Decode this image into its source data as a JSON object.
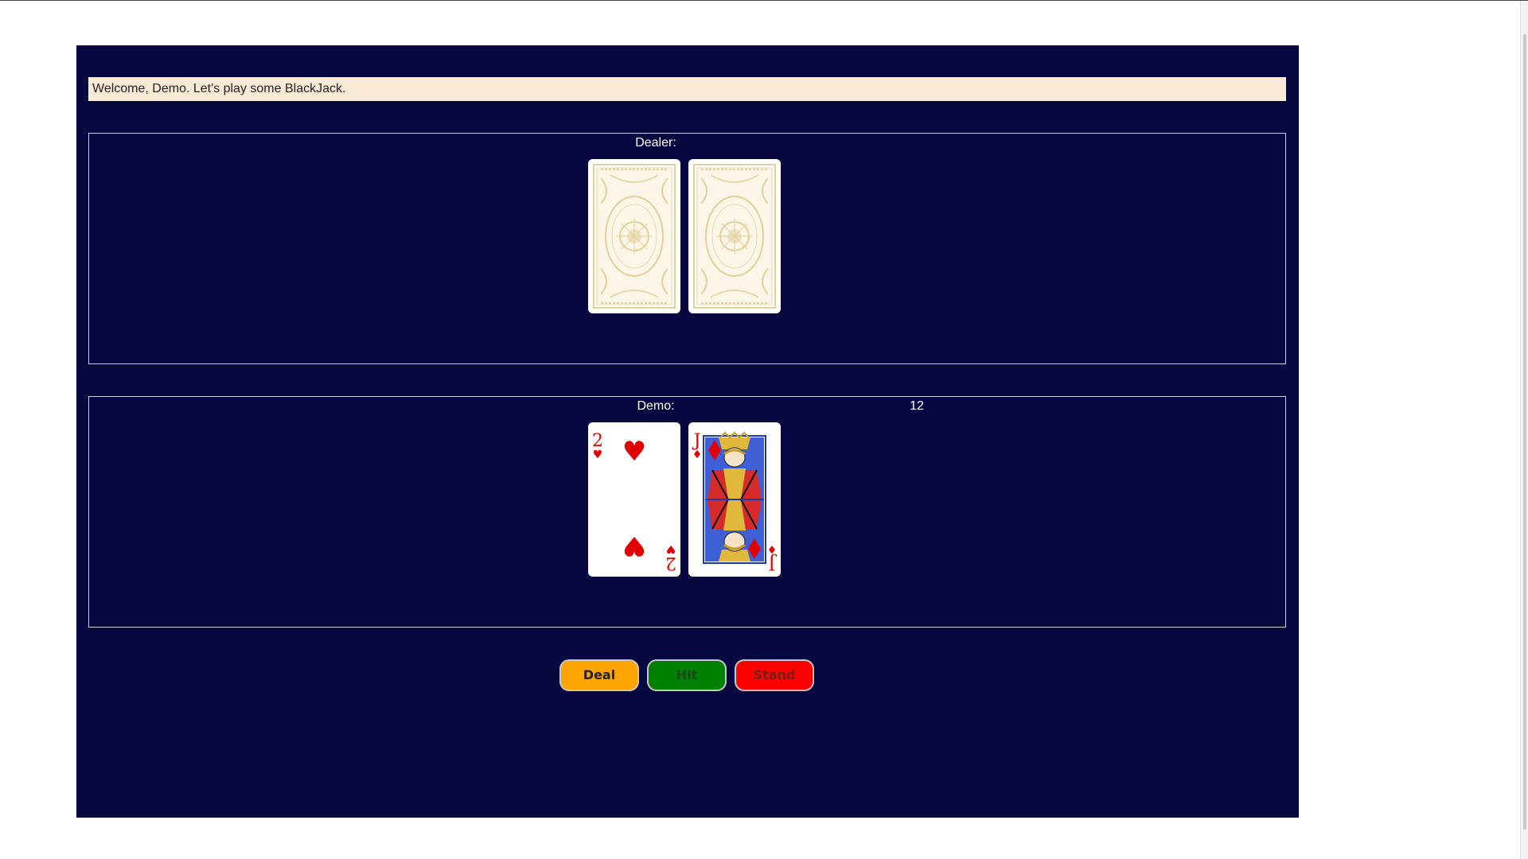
{
  "welcome": {
    "text": "Welcome, Demo. Let's play some BlackJack."
  },
  "dealer": {
    "label": "Dealer:",
    "cards": [
      {
        "face": "back"
      },
      {
        "face": "back"
      }
    ]
  },
  "player": {
    "label": "Demo:",
    "score": "12",
    "cards": [
      {
        "rank": "2",
        "suit": "hearts",
        "suit_symbol": "♥"
      },
      {
        "rank": "J",
        "suit": "diamonds",
        "suit_symbol": "♦"
      }
    ]
  },
  "buttons": {
    "deal": "Deal",
    "hit": "Hit",
    "stand": "Stand"
  },
  "colors": {
    "table": "#070840",
    "welcome_bg": "#f9ead6",
    "card_back_pattern": "#e3cf9a",
    "suit_red": "#e00000",
    "deal": "#ffa500",
    "hit": "#008000",
    "stand": "#ff0000"
  }
}
